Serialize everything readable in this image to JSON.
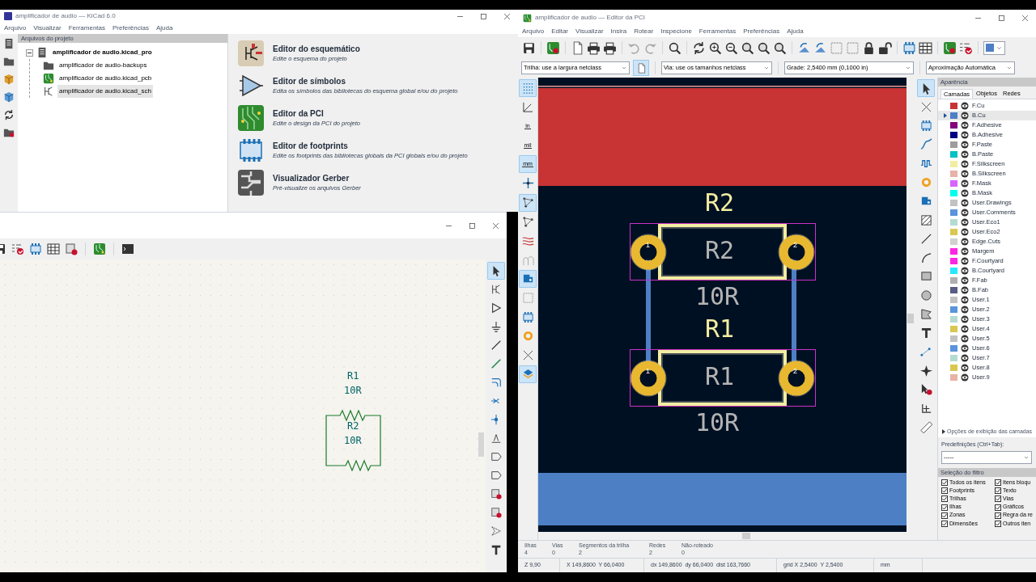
{
  "project_window": {
    "title": "amplificador de audio — KiCad 6.0",
    "menu": [
      "Arquivo",
      "Visualizar",
      "Ferramentas",
      "Preferências",
      "Ajuda"
    ],
    "tree_header": "Arquivos do projeto",
    "tree": [
      {
        "label": "amplificador de audio.kicad_pro",
        "kind": "project",
        "expanded": true,
        "selected": false,
        "children": [
          {
            "label": "amplificador de audio-backups",
            "kind": "folder",
            "selected": false
          },
          {
            "label": "amplificador de audio.kicad_pcb",
            "kind": "pcb",
            "selected": false
          },
          {
            "label": "amplificador de audio.kicad_sch",
            "kind": "schematic",
            "selected": true
          }
        ]
      }
    ],
    "launchers": [
      {
        "kind": "schematic",
        "title": "Editor do esquemático",
        "description": "Edite o esquema do projeto"
      },
      {
        "kind": "symbol",
        "title": "Editor de símbolos",
        "description": "Edita os símbolos das bibliotecas do esquema global e/ou do projeto"
      },
      {
        "kind": "pcb",
        "title": "Editor da PCI",
        "description": "Edite o design da PCI do projeto"
      },
      {
        "kind": "footprint",
        "title": "Editor de footprints",
        "description": "Edite os footprints das bibliotecas globais da PCI globais e/ou do projeto"
      },
      {
        "kind": "gerber",
        "title": "Visualizador Gerber",
        "description": "Pré-visualize os arquivos Gerber"
      }
    ]
  },
  "schematic_window": {
    "tools": [
      {
        "kind": "pointer",
        "on": true
      },
      {
        "kind": "symbol",
        "on": false
      },
      {
        "kind": "triangle",
        "on": false
      },
      {
        "kind": "ground",
        "on": false
      },
      {
        "kind": "line",
        "on": false
      },
      {
        "kind": "wire",
        "on": false
      },
      {
        "kind": "bus",
        "on": false
      },
      {
        "kind": "noconnect",
        "on": false
      },
      {
        "kind": "junction",
        "on": false
      },
      {
        "kind": "label",
        "on": false
      },
      {
        "kind": "tag",
        "on": false
      },
      {
        "kind": "tag",
        "on": false
      },
      {
        "kind": "sheet",
        "on": false
      },
      {
        "kind": "sheet",
        "on": false
      },
      {
        "kind": "dashpoly",
        "on": false
      },
      {
        "kind": "letter",
        "on": false
      }
    ],
    "symbols": [
      {
        "reference": "R1",
        "value": "10R"
      },
      {
        "reference": "R2",
        "value": "10R"
      }
    ]
  },
  "pcb_window": {
    "title": "amplificador de audio — Editor da PCI",
    "menu": [
      "Arquivo",
      "Editar",
      "Visualizar",
      "Insira",
      "Rotear",
      "Inspecione",
      "Ferramentas",
      "Preferências",
      "Ajuda"
    ],
    "track_width": "Trilha: use a largura netclass",
    "via_size": "Via: use os tamanhos netclass",
    "grid": "Grade: 2,5400 mm (0,1000 in)",
    "zoom": "Aproximação Automática",
    "left_tools": [
      {
        "kind": "dotgrid",
        "on": true
      },
      {
        "kind": "polar",
        "on": false
      },
      {
        "kind": "unit",
        "label": "in",
        "on": false
      },
      {
        "kind": "unit",
        "label": "mil",
        "on": false
      },
      {
        "kind": "unit",
        "label": "mm",
        "on": true
      },
      {
        "kind": "cursor",
        "on": false
      },
      {
        "kind": "ratsnest",
        "on": true
      },
      {
        "kind": "ratsnest",
        "on": false
      },
      {
        "kind": "waves",
        "on": false
      },
      {
        "kind": "arches",
        "on": false
      },
      {
        "kind": "pad",
        "on": true
      },
      {
        "kind": "dashed",
        "on": false
      },
      {
        "kind": "chip",
        "on": false
      },
      {
        "kind": "ring",
        "on": false
      },
      {
        "kind": "cross",
        "on": false
      },
      {
        "kind": "layers",
        "on": true
      }
    ],
    "right_tools": [
      {
        "kind": "pointer",
        "on": true
      },
      {
        "kind": "cross",
        "on": false
      },
      {
        "kind": "chip",
        "on": false
      },
      {
        "kind": "curve",
        "on": false
      },
      {
        "kind": "meander",
        "on": false
      },
      {
        "kind": "ring",
        "on": false
      },
      {
        "kind": "pad",
        "on": false
      },
      {
        "kind": "hatch",
        "on": false
      },
      {
        "kind": "line",
        "on": false
      },
      {
        "kind": "arc",
        "on": false
      },
      {
        "kind": "square",
        "on": false
      },
      {
        "kind": "circle",
        "on": false
      },
      {
        "kind": "polygon",
        "on": false
      },
      {
        "kind": "letter",
        "on": false
      },
      {
        "kind": "dim",
        "on": false
      },
      {
        "kind": "anchor",
        "on": false
      },
      {
        "kind": "pointerdel",
        "on": false
      },
      {
        "kind": "origin",
        "on": false
      },
      {
        "kind": "ruler",
        "on": false
      }
    ],
    "footprints": [
      {
        "reference": "R2",
        "fab": "R2",
        "value": "10R",
        "pads": [
          "1",
          "2"
        ]
      },
      {
        "reference": "R1",
        "fab": "R1",
        "value": "10R",
        "pads": [
          "1",
          "2"
        ]
      }
    ],
    "appearance": {
      "title": "Aparência",
      "tabs": [
        {
          "label": "Camadas",
          "selected": true
        },
        {
          "label": "Objetos",
          "selected": false
        },
        {
          "label": "Redes",
          "selected": false
        }
      ],
      "layers": [
        {
          "name": "F.Cu",
          "color": "#c83434",
          "active": false
        },
        {
          "name": "B.Cu",
          "color": "#4d7fc4",
          "active": true
        },
        {
          "name": "F.Adhesive",
          "color": "#84007c",
          "active": false
        },
        {
          "name": "B.Adhesive",
          "color": "#000084",
          "active": false
        },
        {
          "name": "F.Paste",
          "color": "#a09c9c",
          "active": false
        },
        {
          "name": "B.Paste",
          "color": "#00c2c2",
          "active": false
        },
        {
          "name": "F.Silkscreen",
          "color": "#f2eda1",
          "active": false
        },
        {
          "name": "B.Silkscreen",
          "color": "#e8b2a7",
          "active": false
        },
        {
          "name": "F.Mask",
          "color": "#d864ff",
          "active": false
        },
        {
          "name": "B.Mask",
          "color": "#02ffee",
          "active": false
        },
        {
          "name": "User.Drawings",
          "color": "#c2c2c2",
          "active": false
        },
        {
          "name": "User.Comments",
          "color": "#5994dc",
          "active": false
        },
        {
          "name": "User.Eco1",
          "color": "#b4dbd2",
          "active": false
        },
        {
          "name": "User.Eco2",
          "color": "#d8c852",
          "active": false
        },
        {
          "name": "Edge.Cuts",
          "color": "#d0d2cd",
          "active": false
        },
        {
          "name": "Margem",
          "color": "#ff26e2",
          "active": false
        },
        {
          "name": "F.Courtyard",
          "color": "#ff26e2",
          "active": false
        },
        {
          "name": "B.Courtyard",
          "color": "#26e9ff",
          "active": false
        },
        {
          "name": "F.Fab",
          "color": "#afafaf",
          "active": false
        },
        {
          "name": "B.Fab",
          "color": "#585d84",
          "active": false
        },
        {
          "name": "User.1",
          "color": "#c2c2c2",
          "active": false
        },
        {
          "name": "User.2",
          "color": "#5994dc",
          "active": false
        },
        {
          "name": "User.3",
          "color": "#b4dbd2",
          "active": false
        },
        {
          "name": "User.4",
          "color": "#d8c852",
          "active": false
        },
        {
          "name": "User.5",
          "color": "#c2c2c2",
          "active": false
        },
        {
          "name": "User.6",
          "color": "#5994dc",
          "active": false
        },
        {
          "name": "User.7",
          "color": "#b4dbd2",
          "active": false
        },
        {
          "name": "User.8",
          "color": "#d8c852",
          "active": false
        },
        {
          "name": "User.9",
          "color": "#e8b2a7",
          "active": false
        }
      ],
      "display_options": "Opções de exibição das camadas",
      "presets_label": "Predefinições (Ctrl+Tab):",
      "preset": "-----"
    },
    "filter": {
      "title": "Seleção do filtro",
      "items": [
        {
          "label": "Todos os itens",
          "checked": true
        },
        {
          "label": "Itens bloqu",
          "checked": true
        },
        {
          "label": "Footprints",
          "checked": true
        },
        {
          "label": "Texto",
          "checked": true
        },
        {
          "label": "Trilhas",
          "checked": true
        },
        {
          "label": "Vias",
          "checked": true
        },
        {
          "label": "Ilhas",
          "checked": true
        },
        {
          "label": "Gráficos",
          "checked": true
        },
        {
          "label": "Zonas",
          "checked": true
        },
        {
          "label": "Regra da re",
          "checked": true
        },
        {
          "label": "Dimensões",
          "checked": true
        },
        {
          "label": "Outros iten",
          "checked": true
        }
      ]
    },
    "stats": [
      {
        "label": "Ilhas",
        "value": "4"
      },
      {
        "label": "Vias",
        "value": "0"
      },
      {
        "label": "Segmentos da trilha",
        "value": "2"
      },
      {
        "label": "Redes",
        "value": "2"
      },
      {
        "label": "Não-roteado",
        "value": "0"
      }
    ],
    "status": [
      "Z 9,90",
      "X 149,8600  Y 66,0400",
      "dx 149,8600  dy 66,0400  dist 163,7660",
      "grid X 2,5400  Y 2,5400",
      "mm"
    ]
  }
}
